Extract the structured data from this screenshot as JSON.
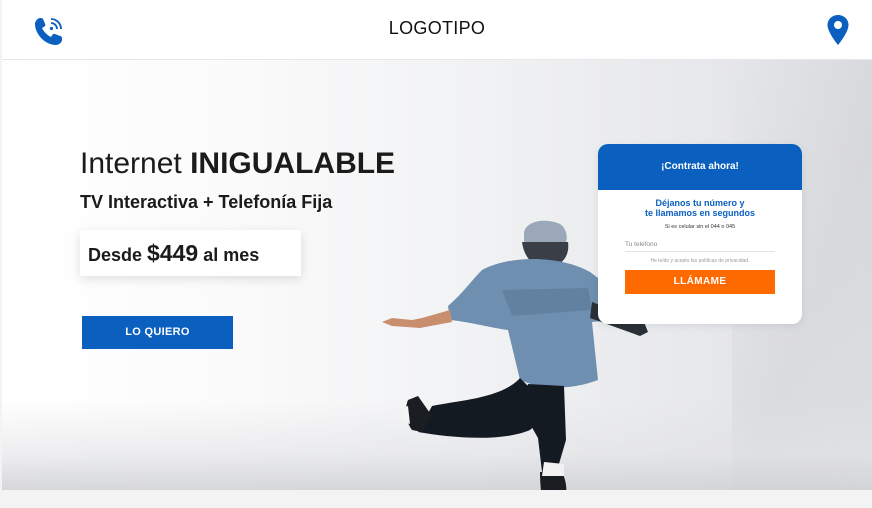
{
  "header": {
    "logo": "LOGOTIPO",
    "phone_icon": "phone-icon",
    "location_icon": "map-pin-icon"
  },
  "hero": {
    "title_regular": "Internet ",
    "title_bold": "INIGUALABLE",
    "subtitle": "TV Interactiva + Telefonía Fija",
    "price_prefix": "Desde ",
    "price_amount": "$449",
    "price_suffix": " al mes",
    "cta_label": "LO QUIERO"
  },
  "form": {
    "header": "¡Contrata ahora!",
    "headline_line1": "Déjanos tu número y",
    "headline_line2": "te llamamos en segundos",
    "note": "Si es celular sin el 044 o 045",
    "phone_placeholder": "Tu teléfono",
    "privacy": "He leído y acepto las políticas de privacidad.",
    "submit_label": "LLÁMAME"
  },
  "colors": {
    "primary": "#0a5fbf",
    "accent": "#ff6a00"
  }
}
